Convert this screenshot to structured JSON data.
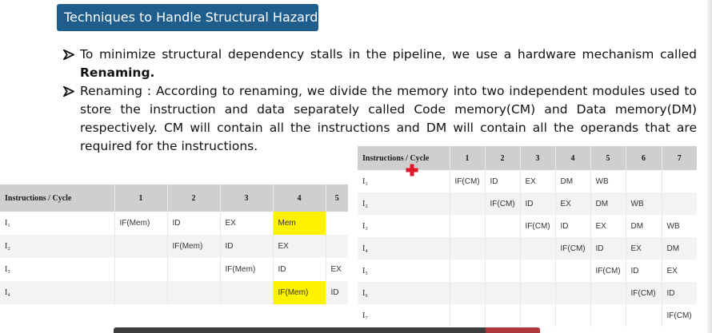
{
  "title": "Techniques to Handle Structural Hazard",
  "bullets": {
    "b1_text": "To minimize structural dependency stalls in the pipeline, we use a hardware mechanism called",
    "b1_bold": "Renaming.",
    "b2_text": "Renaming : According to renaming, we divide the memory into two independent modules used to store the instruction and data separately called Code memory(CM) and Data memory(DM) respectively. CM will contain all the instructions and DM will contain all the operands that are required for the instructions."
  },
  "left_table": {
    "header": [
      "Instructions / Cycle",
      "1",
      "2",
      "3",
      "4",
      "5"
    ],
    "rows": [
      {
        "label": "I₁",
        "cells": [
          "IF(Mem)",
          "ID",
          "EX",
          "Mem",
          ""
        ]
      },
      {
        "label": "I₂",
        "cells": [
          "",
          "IF(Mem)",
          "ID",
          "EX",
          ""
        ]
      },
      {
        "label": "I₃",
        "cells": [
          "",
          "",
          "IF(Mem)",
          "ID",
          "EX"
        ]
      },
      {
        "label": "I₄",
        "cells": [
          "",
          "",
          "",
          "IF(Mem)",
          "ID"
        ]
      }
    ],
    "highlight_color": "#fff200"
  },
  "right_table": {
    "header": [
      "Instructions / Cycle",
      "1",
      "2",
      "3",
      "4",
      "5",
      "6",
      "7"
    ],
    "rows": [
      {
        "label": "I₁",
        "cells": [
          "IF(CM)",
          "ID",
          "EX",
          "DM",
          "WB",
          "",
          ""
        ]
      },
      {
        "label": "I₂",
        "cells": [
          "",
          "IF(CM)",
          "ID",
          "EX",
          "DM",
          "WB",
          ""
        ]
      },
      {
        "label": "I₃",
        "cells": [
          "",
          "",
          "IF(CM)",
          "ID",
          "EX",
          "DM",
          "WB"
        ]
      },
      {
        "label": "I₄",
        "cells": [
          "",
          "",
          "",
          "IF(CM)",
          "ID",
          "EX",
          "DM"
        ]
      },
      {
        "label": "I₅",
        "cells": [
          "",
          "",
          "",
          "",
          "IF(CM)",
          "ID",
          "EX"
        ]
      },
      {
        "label": "I₆",
        "cells": [
          "",
          "",
          "",
          "",
          "",
          "IF(CM)",
          "ID"
        ]
      },
      {
        "label": "I₇",
        "cells": [
          "",
          "",
          "",
          "",
          "",
          "",
          "IF(CM)"
        ]
      }
    ]
  },
  "colors": {
    "title_bg": "#1f5d8d",
    "header_bg": "#cfcfcf",
    "cursor": "#e0192a"
  },
  "icons": {
    "bullet": "arrow-bullet-icon",
    "cursor": "medical-cross-icon"
  }
}
